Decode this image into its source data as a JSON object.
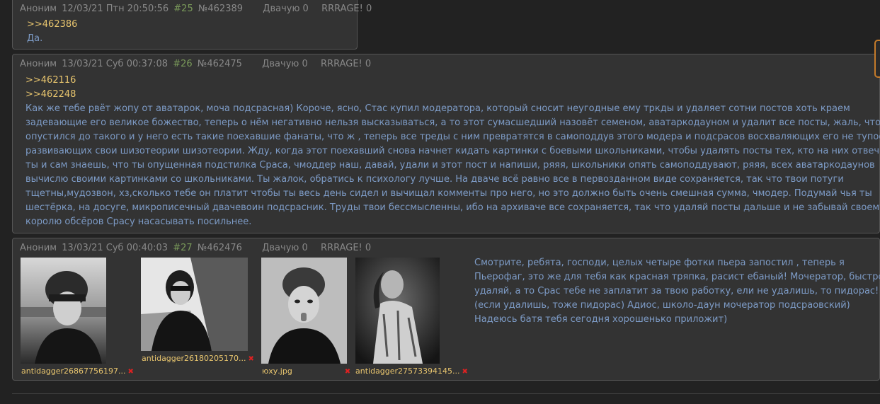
{
  "posts": [
    {
      "author": "Аноним",
      "date": "12/03/21 Птн 20:50:56",
      "index": "#25",
      "id": "№462389",
      "dvach": "Двачую 0",
      "rage": "RRRAGE! 0",
      "replies": [
        ">>462386"
      ],
      "text": "Да."
    },
    {
      "author": "Аноним",
      "date": "13/03/21 Суб 00:37:08",
      "index": "#26",
      "id": "№462475",
      "dvach": "Двачую 0",
      "rage": "RRRAGE! 0",
      "replies": [
        ">>462116",
        ">>462248"
      ],
      "lines": [
        "Как же тебе рвёт жопу от аватарок, моча подсрасная) Короче, ясно, Стас купил модератора, который сносит неугодные ему тркды и удаляет сотни постов хоть краем",
        "задевающие его великое божество, теперь о нём негативно нельзя высказываться, а то этот сумасшедший назовёт семеном, аватаркодауном и удалит все посты, жаль, что Срас",
        "опустился до такого и у него есть такие поехавшие фанаты, что ж , теперь все треды с ним превратятся в самоподдув этого модера и подсрасов восхваляющих его не тупость и",
        "развивающих свои шизотеории шизотеории. Жду, когда этот поехавший снова начнет кидать картинки с боевыми школьниками, чтобы удалять посты тех, кто на них отвечает, но",
        "ты и сам знаешь, что ты опущенная подстилка Сраса, чмоддер наш, давай, удали и этот пост и напиши, ряяя, школьники опять самоподдувают, ряяя, всех аватаркодаунов",
        "вычислю своими картинками со школьниками. Ты жалок, обратись к психологу лучше. На дваче всё равно все в первозданном виде сохраняется, так что твои потуги",
        "тщетны,мудозвон, хз,сколько тебе он платит чтобы ты весь день сидел и вычищал комменты про него, но это должно быть очень смешная сумма, чмодер. Подумай чья ты",
        "шестёрка, на досуге, микрописечный двачевоин подсрасник. Труды твои бессмысленны, ибо на архиваче все сохраняется, так что удаляй посты дальше и не забывай своему",
        "королю обсёров Срасу насасывать посильнее."
      ]
    },
    {
      "author": "Аноним",
      "date": "13/03/21 Суб 00:40:03",
      "index": "#27",
      "id": "№462476",
      "dvach": "Двачую 0",
      "rage": "RRRAGE! 0",
      "files": [
        {
          "name": "antidagger26867756197...",
          "alt": "girl in beanie on beach photo"
        },
        {
          "name": "antidagger26180205170...",
          "alt": "girl with sunglasses by fence photo"
        },
        {
          "name": "юху.jpg",
          "alt": "girl in beanie tongue out photo"
        },
        {
          "name": "antidagger27573394145...",
          "alt": "girl in floral shirt photo"
        }
      ],
      "lines": [
        "Смотрите, ребята, господи, целых четыре фотки пьера запостил , теперь я",
        "Пьерофаг, это же для тебя как красная тряпка, расист ебаный! Мочератор, быстро",
        "удаляй, а то Срас тебе не заплатит за твою работку, ели не удалишь, то пидорас!",
        "(если удалишь, тоже пидорас) Адиос, школо-даун мочератор подсраовский)",
        "Надеюсь батя тебя сегодня хорошенько приложит)"
      ]
    }
  ]
}
